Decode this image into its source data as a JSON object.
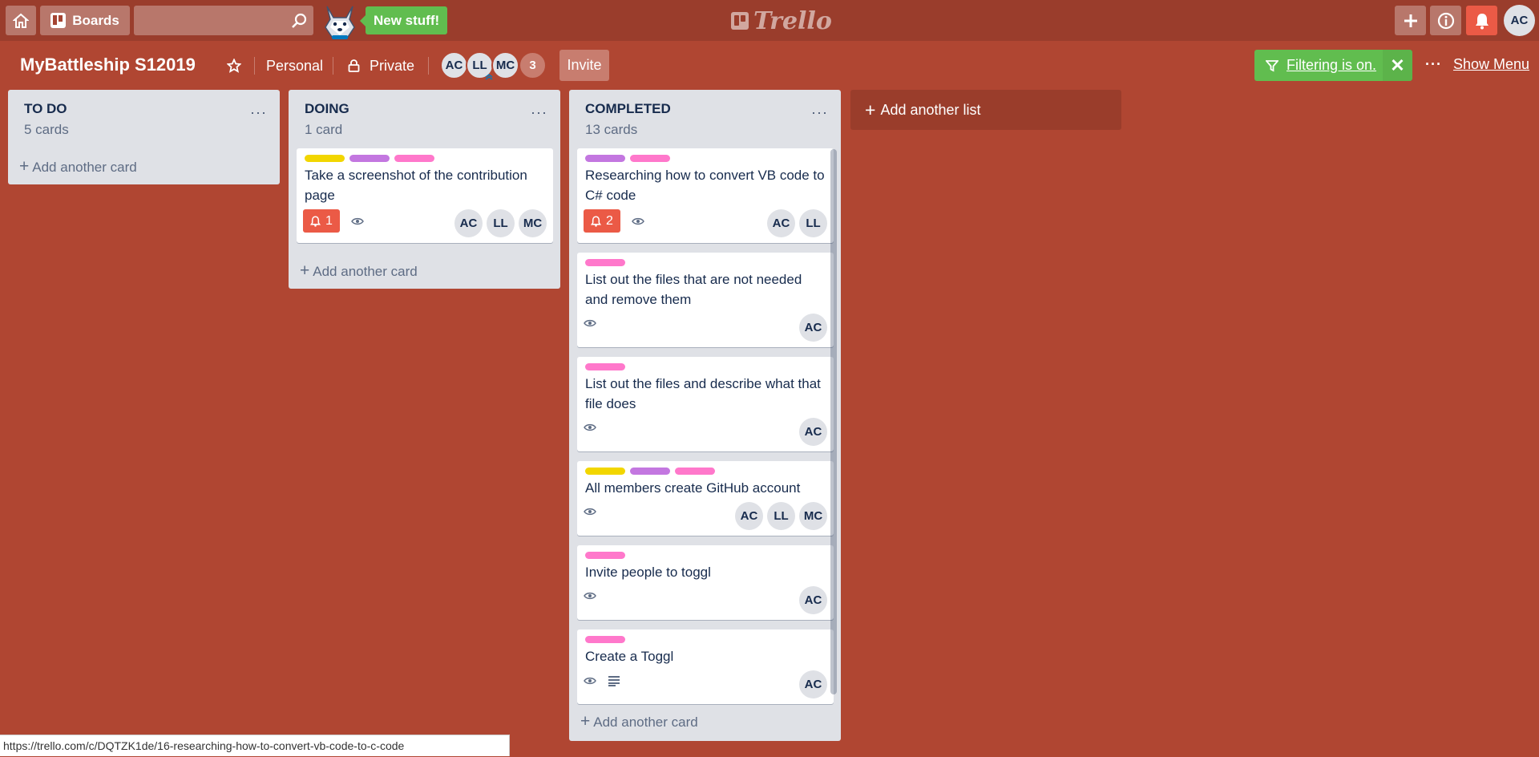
{
  "header": {
    "boards_label": "Boards",
    "search_value": "",
    "new_stuff_label": "New stuff!",
    "logo_text": "Trello",
    "user_initials": "AC"
  },
  "board": {
    "title": "MyBattleship S12019",
    "team": "Personal",
    "visibility": "Private",
    "members": [
      "AC",
      "LL",
      "MC"
    ],
    "more_members": "3",
    "invite_label": "Invite",
    "filter_label": "Filtering is on.",
    "show_menu_label": "Show Menu"
  },
  "colors": {
    "board_bg": "#b04632",
    "label_yellow": "#f2d600",
    "label_purple": "#c377e0",
    "label_pink": "#ff78cb",
    "filter_green": "#61bd4f",
    "due_red": "#eb5a46"
  },
  "lists": [
    {
      "name": "TO DO",
      "count": "5 cards",
      "add_card_label": "Add another card",
      "cards": []
    },
    {
      "name": "DOING",
      "count": "1 card",
      "add_card_label": "Add another card",
      "cards": [
        {
          "labels": [
            "yellow",
            "purple",
            "pink"
          ],
          "title": "Take a screenshot of the contribution page",
          "due_count": "1",
          "members": [
            "AC",
            "LL",
            "MC"
          ]
        }
      ]
    },
    {
      "name": "COMPLETED",
      "count": "13 cards",
      "add_card_label": "Add another card",
      "cards": [
        {
          "labels": [
            "purple",
            "pink"
          ],
          "title": "Researching how to convert VB code to C# code",
          "due_count": "2",
          "members": [
            "AC",
            "LL"
          ]
        },
        {
          "labels": [
            "pink"
          ],
          "title": "List out the files that are not needed and remove them",
          "members": [
            "AC"
          ]
        },
        {
          "labels": [
            "pink"
          ],
          "title": "List out the files and describe what that file does",
          "members": [
            "AC"
          ]
        },
        {
          "labels": [
            "yellow",
            "purple",
            "pink"
          ],
          "title": "All members create GitHub account",
          "members": [
            "AC",
            "LL",
            "MC"
          ]
        },
        {
          "labels": [
            "pink"
          ],
          "title": "Invite people to toggl",
          "members": [
            "AC"
          ]
        },
        {
          "labels": [
            "pink"
          ],
          "title": "Create a Toggl",
          "has_description": true,
          "members": [
            "AC"
          ]
        }
      ]
    }
  ],
  "add_list_label": "Add another list",
  "status_url": "https://trello.com/c/DQTZK1de/16-researching-how-to-convert-vb-code-to-c-code"
}
